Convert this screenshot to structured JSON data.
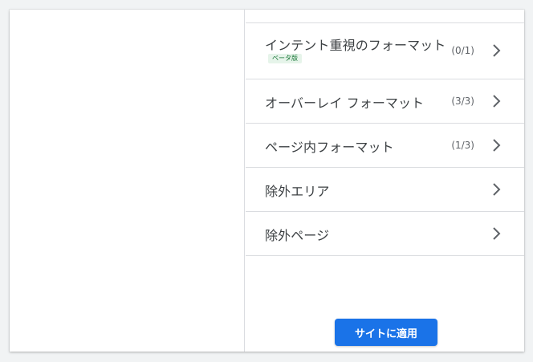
{
  "format_list": {
    "items": [
      {
        "title": "インテント重視のフォーマット",
        "badge": "ベータ版",
        "count": "(0/1)"
      },
      {
        "title": "オーバーレイ フォーマット",
        "count": "(3/3)"
      },
      {
        "title": "ページ内フォーマット",
        "count": "(1/3)"
      },
      {
        "title": "除外エリア"
      },
      {
        "title": "除外ページ"
      }
    ]
  },
  "footer": {
    "apply_label": "サイトに適用"
  },
  "colors": {
    "accent": "#1a73e8",
    "divider": "#dadce0",
    "beta_bg": "#e6f4ea",
    "beta_text": "#137333"
  },
  "icons": {
    "row_chevron": "chevron-right-icon"
  }
}
